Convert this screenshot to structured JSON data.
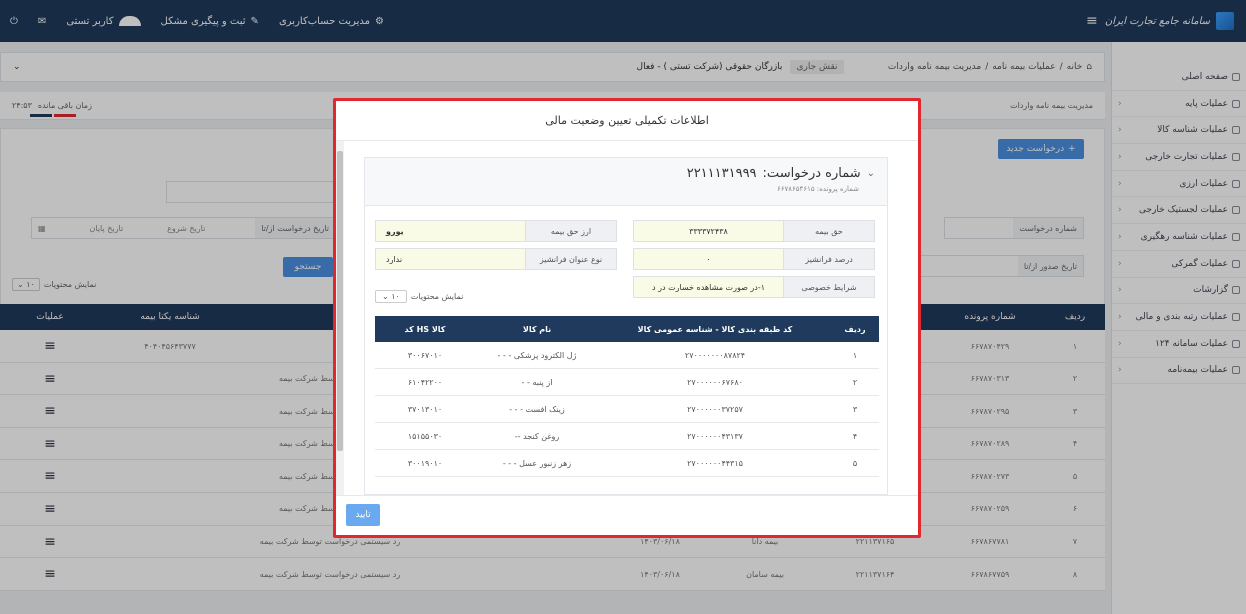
{
  "header": {
    "brand": "سامانه جامع تجارت ایران",
    "account_management": "مدیریت حساب‌کاربری",
    "issue_tracking": "ثبت و پیگیری مشکل",
    "user_name": "کاربر تستی"
  },
  "sidebar": {
    "items": [
      {
        "label": "صفحه اصلی",
        "has_children": false
      },
      {
        "label": "عملیات پایه",
        "has_children": true
      },
      {
        "label": "عملیات شناسه کالا",
        "has_children": true
      },
      {
        "label": "عملیات تجارت خارجی",
        "has_children": true
      },
      {
        "label": "عملیات ارزی",
        "has_children": true
      },
      {
        "label": "عملیات لجستیک خارجی",
        "has_children": true
      },
      {
        "label": "عملیات شناسه رهگیری",
        "has_children": true
      },
      {
        "label": "عملیات گمرکی",
        "has_children": true
      },
      {
        "label": "گزارشات",
        "has_children": true
      },
      {
        "label": "عملیات رتبه بندی و مالی",
        "has_children": true
      },
      {
        "label": "عملیات سامانه ۱۲۴",
        "has_children": true
      },
      {
        "label": "عملیات بیمه‌نامه",
        "has_children": true
      }
    ]
  },
  "breadcrumb": {
    "home": "خانه",
    "sep": "/",
    "level1": "عملیات بیمه نامه",
    "level2": "مدیریت بیمه نامه واردات"
  },
  "role": {
    "label": "نقش جاری",
    "value": "بازرگان حقوقی (شرکت تستی ) - فعال"
  },
  "sub_bar": {
    "page_title": "مدیریت بیمه نامه واردات",
    "time_left_label": "زمان باقی مانده",
    "time_left_value": "۲۴:۵۳"
  },
  "filters": {
    "new_request": "درخواست جدید",
    "request_number_label": "شماره درخواست",
    "request_date_label": "تاریخ درخواست از/تا",
    "start_date_placeholder": "تاریخ شروع",
    "end_date_placeholder": "تاریخ پایان",
    "issue_date_label": "تاریخ صدور از/تا",
    "search": "جستجو",
    "show_count_label": "نمایش محتویات",
    "show_count_value": "۱۰"
  },
  "bg_table": {
    "headers": {
      "row": "ردیف",
      "file_number": "شماره پرونده",
      "unique_insurance_id": "شناسه یکتا بیمه",
      "operations": "عملیات"
    },
    "rows": [
      {
        "row": "۱",
        "file": "۶۶۷۸۷۰۴۲۹",
        "unique": "۴۰۴۰۴۵۶۴۳۷۷۷",
        "insurer": "",
        "date": "",
        "status": ""
      },
      {
        "row": "۲",
        "file": "۶۶۷۸۷۰۳۱۳",
        "unique": "",
        "insurer": "",
        "date": "",
        "status": "توسط شرکت بیمه"
      },
      {
        "row": "۳",
        "file": "۶۶۷۸۷۰۲۹۵",
        "unique": "",
        "insurer": "",
        "date": "",
        "status": "توسط شرکت بیمه"
      },
      {
        "row": "۴",
        "file": "۶۶۷۸۷۰۲۸۹",
        "unique": "",
        "insurer": "",
        "date": "",
        "status": "توسط شرکت بیمه"
      },
      {
        "row": "۵",
        "file": "۶۶۷۸۷۰۲۷۳",
        "unique": "",
        "insurer": "",
        "date": "",
        "status": "توسط شرکت بیمه"
      },
      {
        "row": "۶",
        "file": "۶۶۷۸۷۰۲۵۹",
        "unique": "",
        "insurer": "",
        "date": "",
        "status": "توسط شرکت بیمه"
      },
      {
        "row": "۷",
        "file": "۶۶۷۸۶۷۷۸۱",
        "unique": "",
        "insurer": "بیمه دانا",
        "date": "۱۴۰۳/۰۶/۱۸",
        "status": "رد سیستمی درخواست توسط شرکت بیمه",
        "num": "۲۲۱۱۳۷۱۶۵"
      },
      {
        "row": "۸",
        "file": "۶۶۷۸۶۷۷۵۹",
        "unique": "",
        "insurer": "بیمه سامان",
        "date": "۱۴۰۳/۰۶/۱۸",
        "status": "رد سیستمی درخواست توسط شرکت بیمه",
        "num": "۲۲۱۱۳۷۱۶۴"
      }
    ]
  },
  "modal": {
    "title": "اطلاعات تکمیلی تعیین وضعیت مالی",
    "request_label": "شماره درخواست:",
    "request_number": "۲۲۱۱۱۳۱۹۹۹",
    "file_number_line": "شماره پرونده: ۶۶۷۸۶۵۴۶۱۵",
    "fields": {
      "premium": {
        "label": "حق بیمه",
        "value": "۳۳۳۳۷۲۴۳۸"
      },
      "premium_currency": {
        "label": "ارز حق بیمه",
        "value": "یورو"
      },
      "franchise_percent": {
        "label": "درصد فرانشیز",
        "value": "۰"
      },
      "franchise_type": {
        "label": "نوع عنوان فرانشیز",
        "value": "ندارد"
      },
      "special_conditions": {
        "label": "شرایط خصوصی",
        "value": "۱-در صورت مشاهده خسارت در د"
      }
    },
    "show_count_label": "نمایش محتویات",
    "show_count_value": "۱۰",
    "table": {
      "headers": {
        "row": "ردیف",
        "classification": "کد طبقه بندی کالا - شناسه عمومی کالا",
        "name": "نام کالا",
        "hs": "کد HS کالا"
      },
      "rows": [
        {
          "row": "۱",
          "classification": "۲۷۰۰۰۰۰۰۰۸۷۸۲۴",
          "name": "- - - ژل الکترود پزشکی",
          "hs": "۳۰۰۶۷۰۱۰"
        },
        {
          "row": "۲",
          "classification": "۲۷۰۰۰۰۰۰۶۷۶۸۰",
          "name": "- - از پنبه",
          "hs": "۶۱۰۴۲۲۰۰"
        },
        {
          "row": "۳",
          "classification": "۲۷۰۰۰۰۰۰۳۷۲۵۷",
          "name": "- - - زینک افست",
          "hs": "۳۷۰۱۳۰۱۰"
        },
        {
          "row": "۴",
          "classification": "۲۷۰۰۰۰۰۰۴۳۱۳۷",
          "name": "-- روغن کنجد",
          "hs": "۱۵۱۵۵۰۳۰"
        },
        {
          "row": "۵",
          "classification": "۲۷۰۰۰۰۰۰۴۴۳۱۵",
          "name": "- - - زهر زنبور عسل",
          "hs": "۳۰۰۱۹۰۱۰"
        }
      ]
    },
    "confirm": "تایید"
  },
  "colors": {
    "header_bg": "#1f3a5c",
    "accent_blue": "#4a90e2",
    "modal_frame": "#e0282e",
    "field_value_bg": "#fafbe6"
  }
}
